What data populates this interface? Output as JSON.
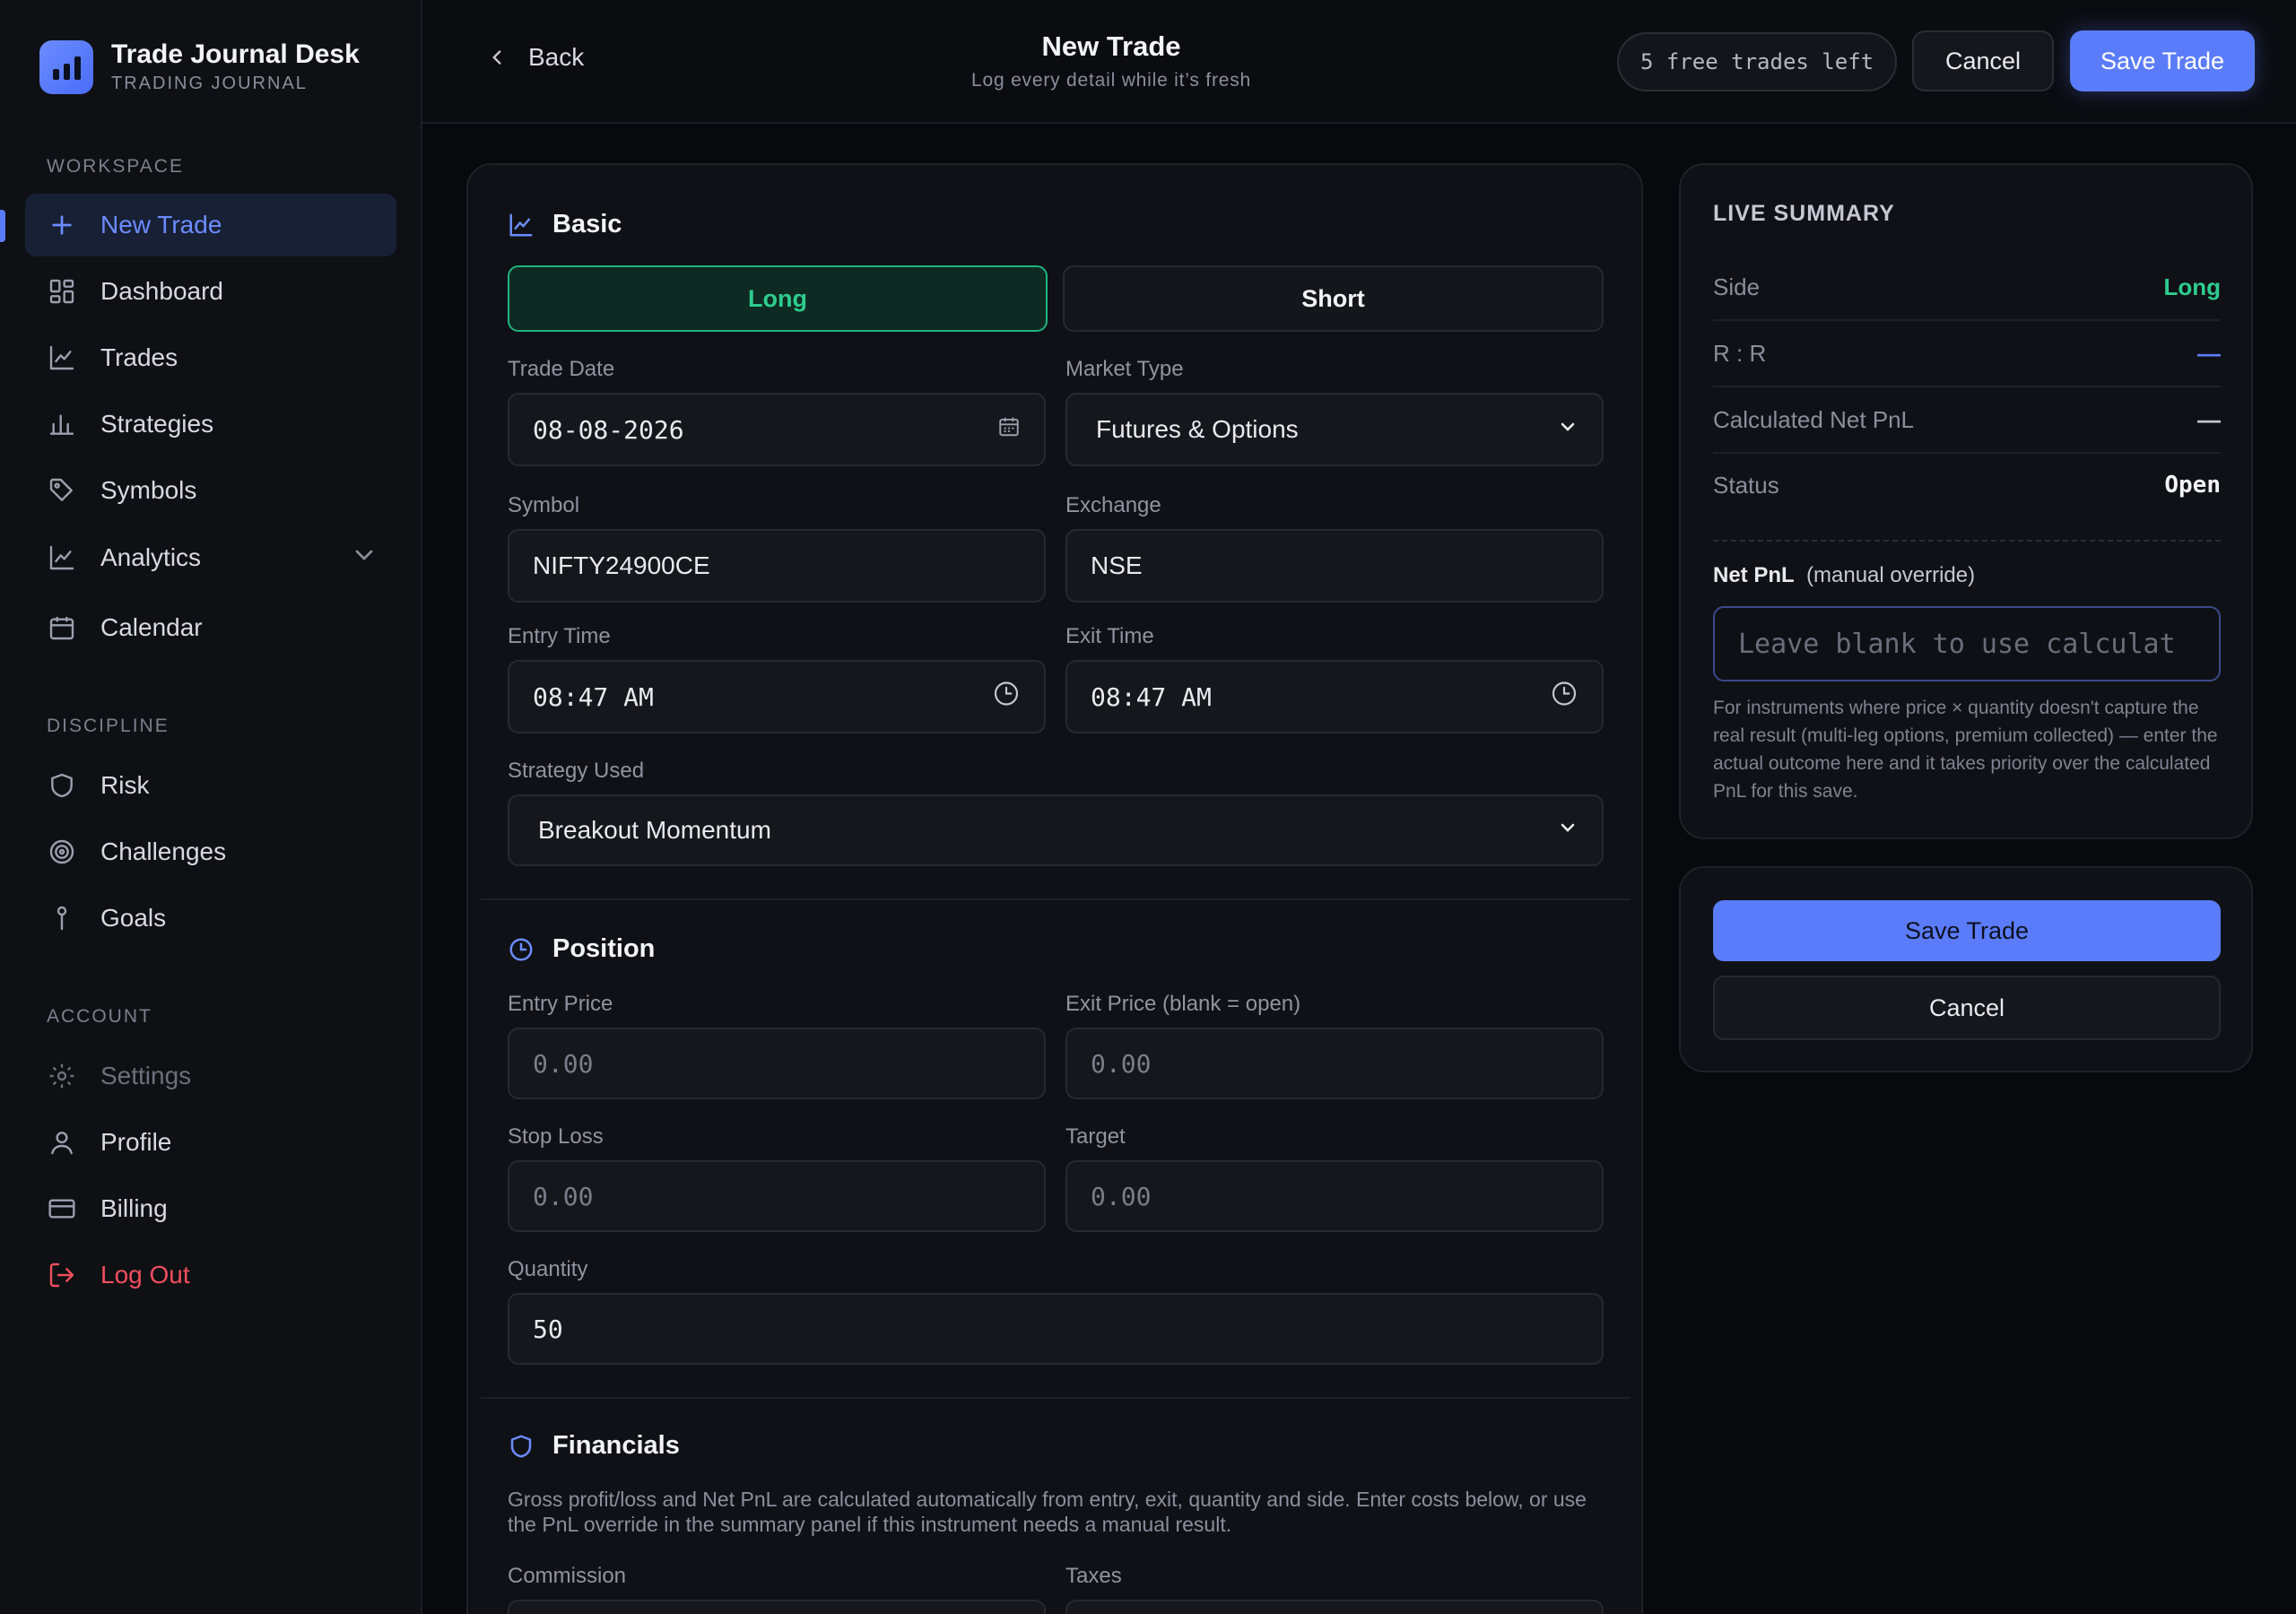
{
  "brand": {
    "title": "Trade Journal Desk",
    "subtitle": "TRADING JOURNAL"
  },
  "sidebar": {
    "workspace_label": "WORKSPACE",
    "discipline_label": "DISCIPLINE",
    "account_label": "ACCOUNT",
    "workspace": [
      {
        "label": "New Trade",
        "icon": "plus-icon",
        "active": true
      },
      {
        "label": "Dashboard",
        "icon": "grid-icon"
      },
      {
        "label": "Trades",
        "icon": "chart-line-icon"
      },
      {
        "label": "Strategies",
        "icon": "bar-chart-icon"
      },
      {
        "label": "Symbols",
        "icon": "tag-icon"
      },
      {
        "label": "Analytics",
        "icon": "chart-line-icon",
        "expandable": true
      },
      {
        "label": "Calendar",
        "icon": "calendar-icon"
      }
    ],
    "discipline": [
      {
        "label": "Risk",
        "icon": "shield-icon"
      },
      {
        "label": "Challenges",
        "icon": "target-icon"
      },
      {
        "label": "Goals",
        "icon": "pin-icon"
      }
    ],
    "account": [
      {
        "label": "Settings",
        "icon": "gear-icon"
      },
      {
        "label": "Profile",
        "icon": "user-icon"
      },
      {
        "label": "Billing",
        "icon": "credit-card-icon"
      },
      {
        "label": "Log Out",
        "icon": "logout-icon"
      }
    ]
  },
  "header": {
    "back_label": "Back",
    "title": "New Trade",
    "subtitle": "Log every detail while it’s fresh",
    "free_trades": "5 free trades left",
    "cancel_label": "Cancel",
    "save_label": "Save Trade"
  },
  "form": {
    "basic": {
      "title": "Basic",
      "long_label": "Long",
      "short_label": "Short",
      "trade_date_label": "Trade Date",
      "trade_date": "08-08-2026",
      "market_type_label": "Market Type",
      "market_type": "Futures & Options",
      "symbol_label": "Symbol",
      "symbol": "NIFTY24900CE",
      "exchange_label": "Exchange",
      "exchange": "NSE",
      "entry_time_label": "Entry Time",
      "entry_time": "08:47 AM",
      "exit_time_label": "Exit Time",
      "exit_time": "08:47 AM",
      "strategy_label": "Strategy Used",
      "strategy": "Breakout Momentum"
    },
    "position": {
      "title": "Position",
      "entry_price_label": "Entry Price",
      "entry_price_placeholder": "0.00",
      "exit_price_label": "Exit Price (blank = open)",
      "exit_price_placeholder": "0.00",
      "stop_loss_label": "Stop Loss",
      "stop_loss_placeholder": "0.00",
      "target_label": "Target",
      "target_placeholder": "0.00",
      "quantity_label": "Quantity",
      "quantity": "50"
    },
    "financials": {
      "title": "Financials",
      "description": "Gross profit/loss and Net PnL are calculated automatically from entry, exit, quantity and side. Enter costs below, or use the PnL override in the summary panel if this instrument needs a manual result.",
      "commission_label": "Commission",
      "taxes_label": "Taxes"
    }
  },
  "summary": {
    "title": "LIVE SUMMARY",
    "rows": [
      {
        "label": "Side",
        "value": "Long"
      },
      {
        "label": "R : R",
        "value": "—"
      },
      {
        "label": "Calculated Net PnL",
        "value": "—"
      },
      {
        "label": "Status",
        "value": "Open"
      }
    ],
    "override_label_bold": "Net PnL",
    "override_label_rest": "(manual override)",
    "override_placeholder": "Leave blank to use calculat",
    "override_note": "For instruments where price × quantity doesn't capture the real result (multi-leg options, premium collected) — enter the actual outcome here and it takes priority over the calculated PnL for this save.",
    "save_label": "Save Trade",
    "cancel_label": "Cancel"
  },
  "colors": {
    "accent": "#5b7cfa",
    "long": "#2ecc8f",
    "danger": "#f04e5e",
    "background": "#08090c"
  }
}
